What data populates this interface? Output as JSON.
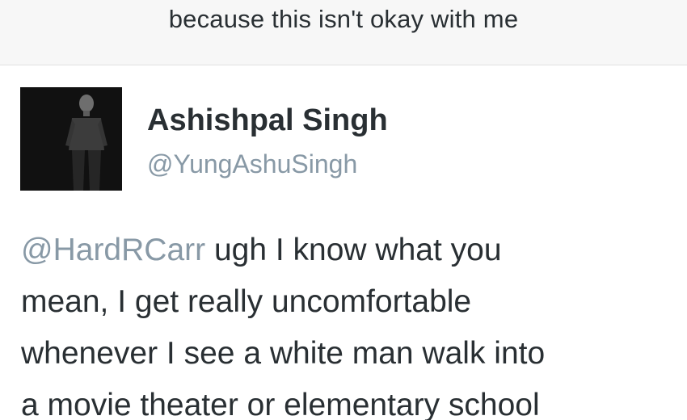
{
  "previous_tweet": {
    "text": "because this isn't okay with me"
  },
  "tweet": {
    "author_name": "Ashishpal Singh",
    "author_handle": "@YungAshuSingh",
    "mention": "@HardRCarr",
    "lines": [
      " ugh I know what you",
      "mean, I get really uncomfortable",
      "whenever I see a white man walk into",
      "a movie theater or elementary school"
    ]
  }
}
